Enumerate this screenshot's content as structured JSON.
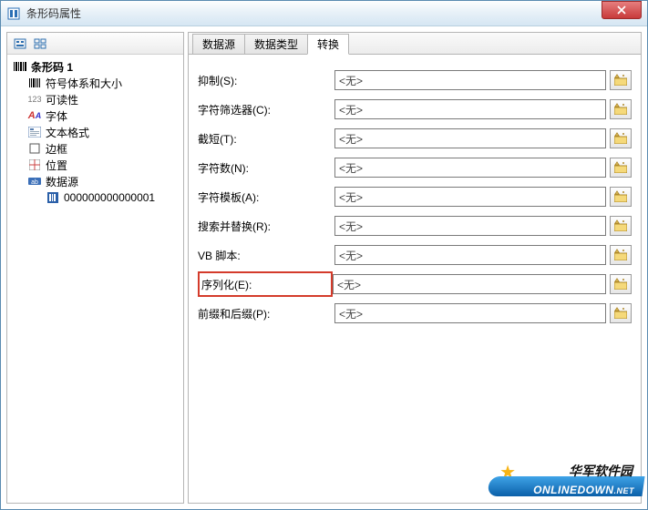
{
  "window": {
    "title": "条形码属性"
  },
  "tree": {
    "root_label": "条形码 1",
    "datasource_value": "000000000000001",
    "items": {
      "symbol": "符号体系和大小",
      "readability": "可读性",
      "font": "字体",
      "textformat": "文本格式",
      "border": "边框",
      "position": "位置",
      "datasource": "数据源"
    }
  },
  "tabs": {
    "datasource": "数据源",
    "datatype": "数据类型",
    "transform": "转换"
  },
  "form": {
    "suppress": {
      "label": "抑制(S):",
      "value": "<无>"
    },
    "charfilter": {
      "label": "字符筛选器(C):",
      "value": "<无>"
    },
    "truncate": {
      "label": "截短(T):",
      "value": "<无>"
    },
    "charcount": {
      "label": "字符数(N):",
      "value": "<无>"
    },
    "chartpl": {
      "label": "字符模板(A):",
      "value": "<无>"
    },
    "searchrep": {
      "label": "搜索并替换(R):",
      "value": "<无>"
    },
    "vbscript": {
      "label": "VB 脚本:",
      "value": "<无>"
    },
    "serialize": {
      "label": "序列化(E):",
      "value": "<无>"
    },
    "prefsuf": {
      "label": "前缀和后缀(P):",
      "value": "<无>"
    }
  },
  "watermark": {
    "cn": "华军软件园",
    "en": "ONLINEDOWN",
    "tld": ".NET"
  }
}
